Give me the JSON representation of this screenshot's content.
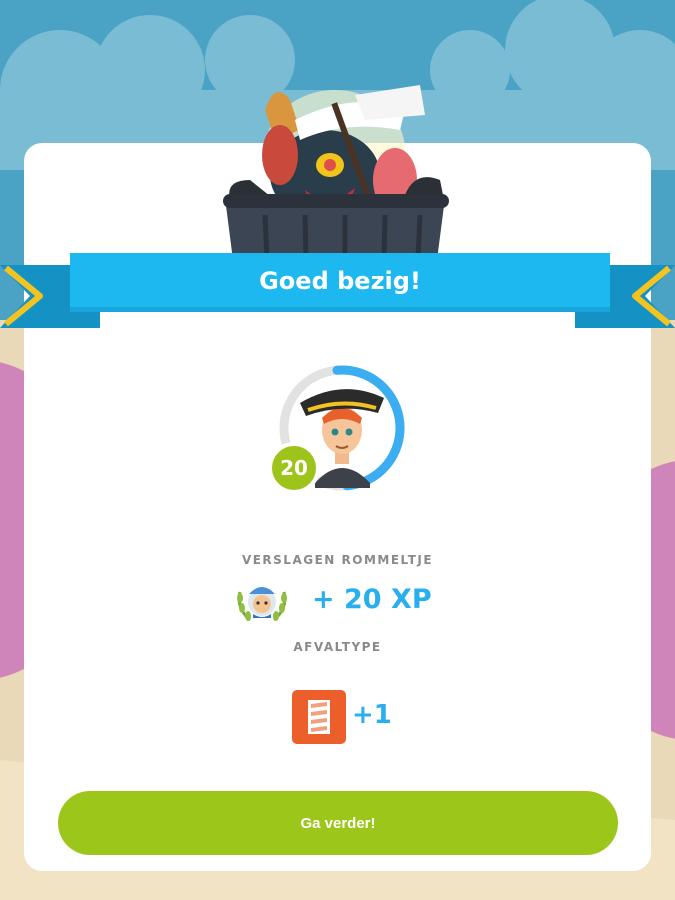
{
  "banner": {
    "title": "Goed bezig!"
  },
  "player": {
    "level": "20",
    "level_progress": 0.5
  },
  "rewards": {
    "defeated_label": "VERSLAGEN ROMMELTJE",
    "xp_text": "+ 20 XP",
    "waste_type_label": "AFVALTYPE",
    "waste_type_count": "+1",
    "waste_type_icon": "paper-waste-icon"
  },
  "actions": {
    "continue_label": "Ga verder!"
  },
  "colors": {
    "ribbon": "#1cb8ef",
    "ribbon_dark": "#1492c4",
    "ribbon_tip": "#f3c322",
    "accent_text": "#29aef0",
    "button": "#9cc61a",
    "level_badge": "#9dc41a",
    "waste_icon_bg": "#ed5f2a"
  }
}
